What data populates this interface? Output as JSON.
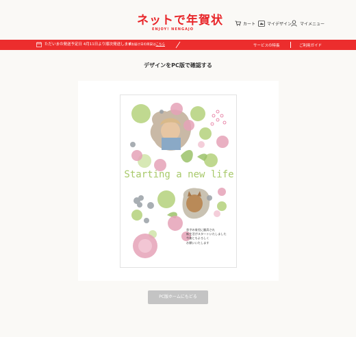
{
  "colors": {
    "brand_red": "#e8262a",
    "bar_red": "#ec2d2d",
    "card_green": "#a8c96a",
    "button_gray": "#c4c4c4"
  },
  "header": {
    "logo_text": "ネットで年賀状",
    "logo_sub": "ENJOY! NENGAJO",
    "nav": [
      {
        "label": "カート",
        "icon": "cart-icon"
      },
      {
        "label": "マイデザイン",
        "icon": "my-design-icon"
      },
      {
        "label": "マイメニュー",
        "icon": "user-icon"
      }
    ]
  },
  "notice": {
    "main_text": "ただいまの発送予定日 4月11日より順次発送します",
    "sub_text": "本お届け日の目安は",
    "sub_link": "こちら",
    "service_link": "サービスの特長",
    "guide_link": "ご利用ガイド"
  },
  "main": {
    "title": "デザインをPC版で確認する",
    "back_button": "PC版ホームにもどる"
  },
  "card": {
    "headline": "Starting a new life",
    "message_lines": [
      "息子の育児に翻弄され",
      "新生活がスタートいたしました",
      "今後ともよろしく",
      "お願いいたします"
    ]
  }
}
